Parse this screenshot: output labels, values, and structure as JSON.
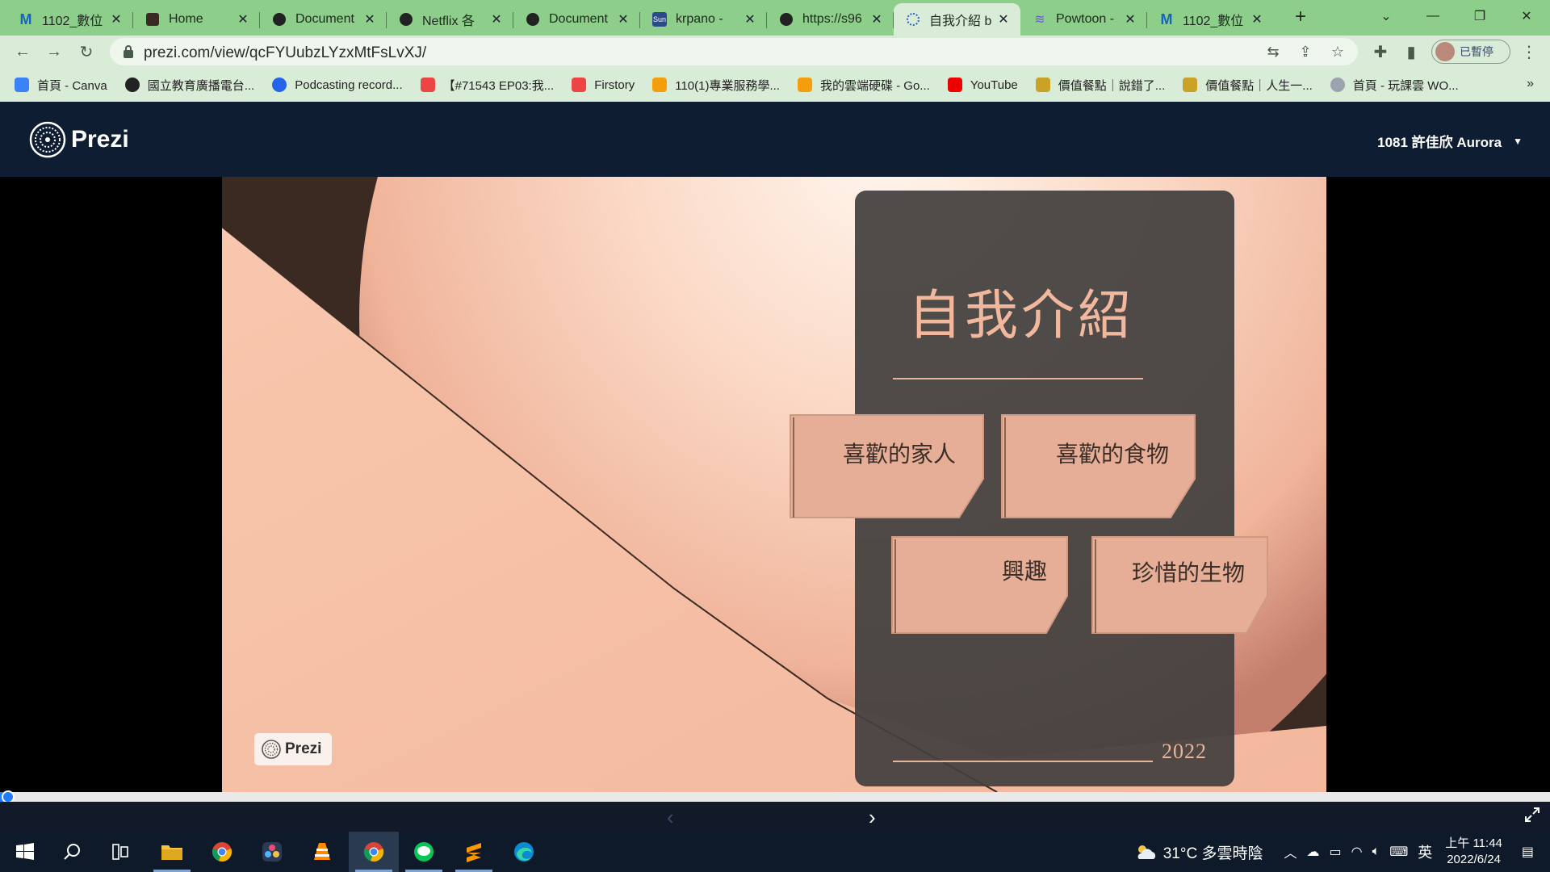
{
  "browser": {
    "tabs": [
      {
        "title": "1102_數位",
        "icon": "m-logo-icon",
        "active": false
      },
      {
        "title": "Home",
        "icon": "avatar-icon",
        "active": false
      },
      {
        "title": "Document",
        "icon": "globe-icon",
        "active": false
      },
      {
        "title": "Netflix 各",
        "icon": "globe-icon",
        "active": false
      },
      {
        "title": "Document",
        "icon": "globe-icon",
        "active": false
      },
      {
        "title": "krpano - ",
        "icon": "sun-icon",
        "active": false
      },
      {
        "title": "https://s96",
        "icon": "globe-icon",
        "active": false
      },
      {
        "title": "自我介紹 b",
        "icon": "prezi-icon",
        "active": true
      },
      {
        "title": "Powtoon - ",
        "icon": "powtoon-icon",
        "active": false
      },
      {
        "title": "1102_數位",
        "icon": "m-logo-icon",
        "active": false
      }
    ],
    "url": "prezi.com/view/qcFYUubzLYzxMtFsLvXJ/",
    "profile_label": "已暫停",
    "bookmarks": [
      {
        "label": "首頁 - Canva",
        "icon": "canva-icon",
        "color": "#3b82f6"
      },
      {
        "label": "國立教育廣播電台...",
        "icon": "globe-icon",
        "color": "#222222"
      },
      {
        "label": "Podcasting record...",
        "icon": "pin-icon",
        "color": "#2563eb"
      },
      {
        "label": "【#71543 EP03:我...",
        "icon": "firstory-icon",
        "color": "#ef4444"
      },
      {
        "label": "Firstory",
        "icon": "firstory-icon",
        "color": "#ef4444"
      },
      {
        "label": "110(1)專業服務學...",
        "icon": "drive-icon",
        "color": "#f59e0b"
      },
      {
        "label": "我的雲端硬碟 - Go...",
        "icon": "drive-icon",
        "color": "#f59e0b"
      },
      {
        "label": "YouTube",
        "icon": "youtube-icon",
        "color": "#ef0000"
      },
      {
        "label": "價值餐點｜說錯了...",
        "icon": "food-icon",
        "color": "#c9a227"
      },
      {
        "label": "價值餐點｜人生一...",
        "icon": "food-icon",
        "color": "#c9a227"
      },
      {
        "label": "首頁 - 玩課雲 WO...",
        "icon": "wo-icon",
        "color": "#9ca3af"
      }
    ]
  },
  "prezi": {
    "brand": "Prezi",
    "user": "1081 許佳欣 Aurora",
    "badge": "Prezi"
  },
  "slide": {
    "title": "自我介紹",
    "cards": [
      "喜歡的家人",
      "喜歡的食物",
      "興趣",
      "珍惜的生物"
    ],
    "year": "2022",
    "colors": {
      "peach": "#f6c3a8",
      "dark": "#3a2a22",
      "panel": "#434140",
      "card": "#e6ae96",
      "accent": "#f2b89d"
    }
  },
  "player": {
    "progress": 0.005
  },
  "taskbar": {
    "apps": [
      "windows-start-icon",
      "search-icon",
      "task-view-icon",
      "file-explorer-icon",
      "chrome-icon",
      "davinci-icon",
      "vlc-icon",
      "chrome-icon",
      "line-icon",
      "sublime-icon",
      "edge-icon"
    ],
    "weather": "31°C 多雲時陰",
    "ime": "英",
    "time": "上午 11:44",
    "date": "2022/6/24"
  }
}
